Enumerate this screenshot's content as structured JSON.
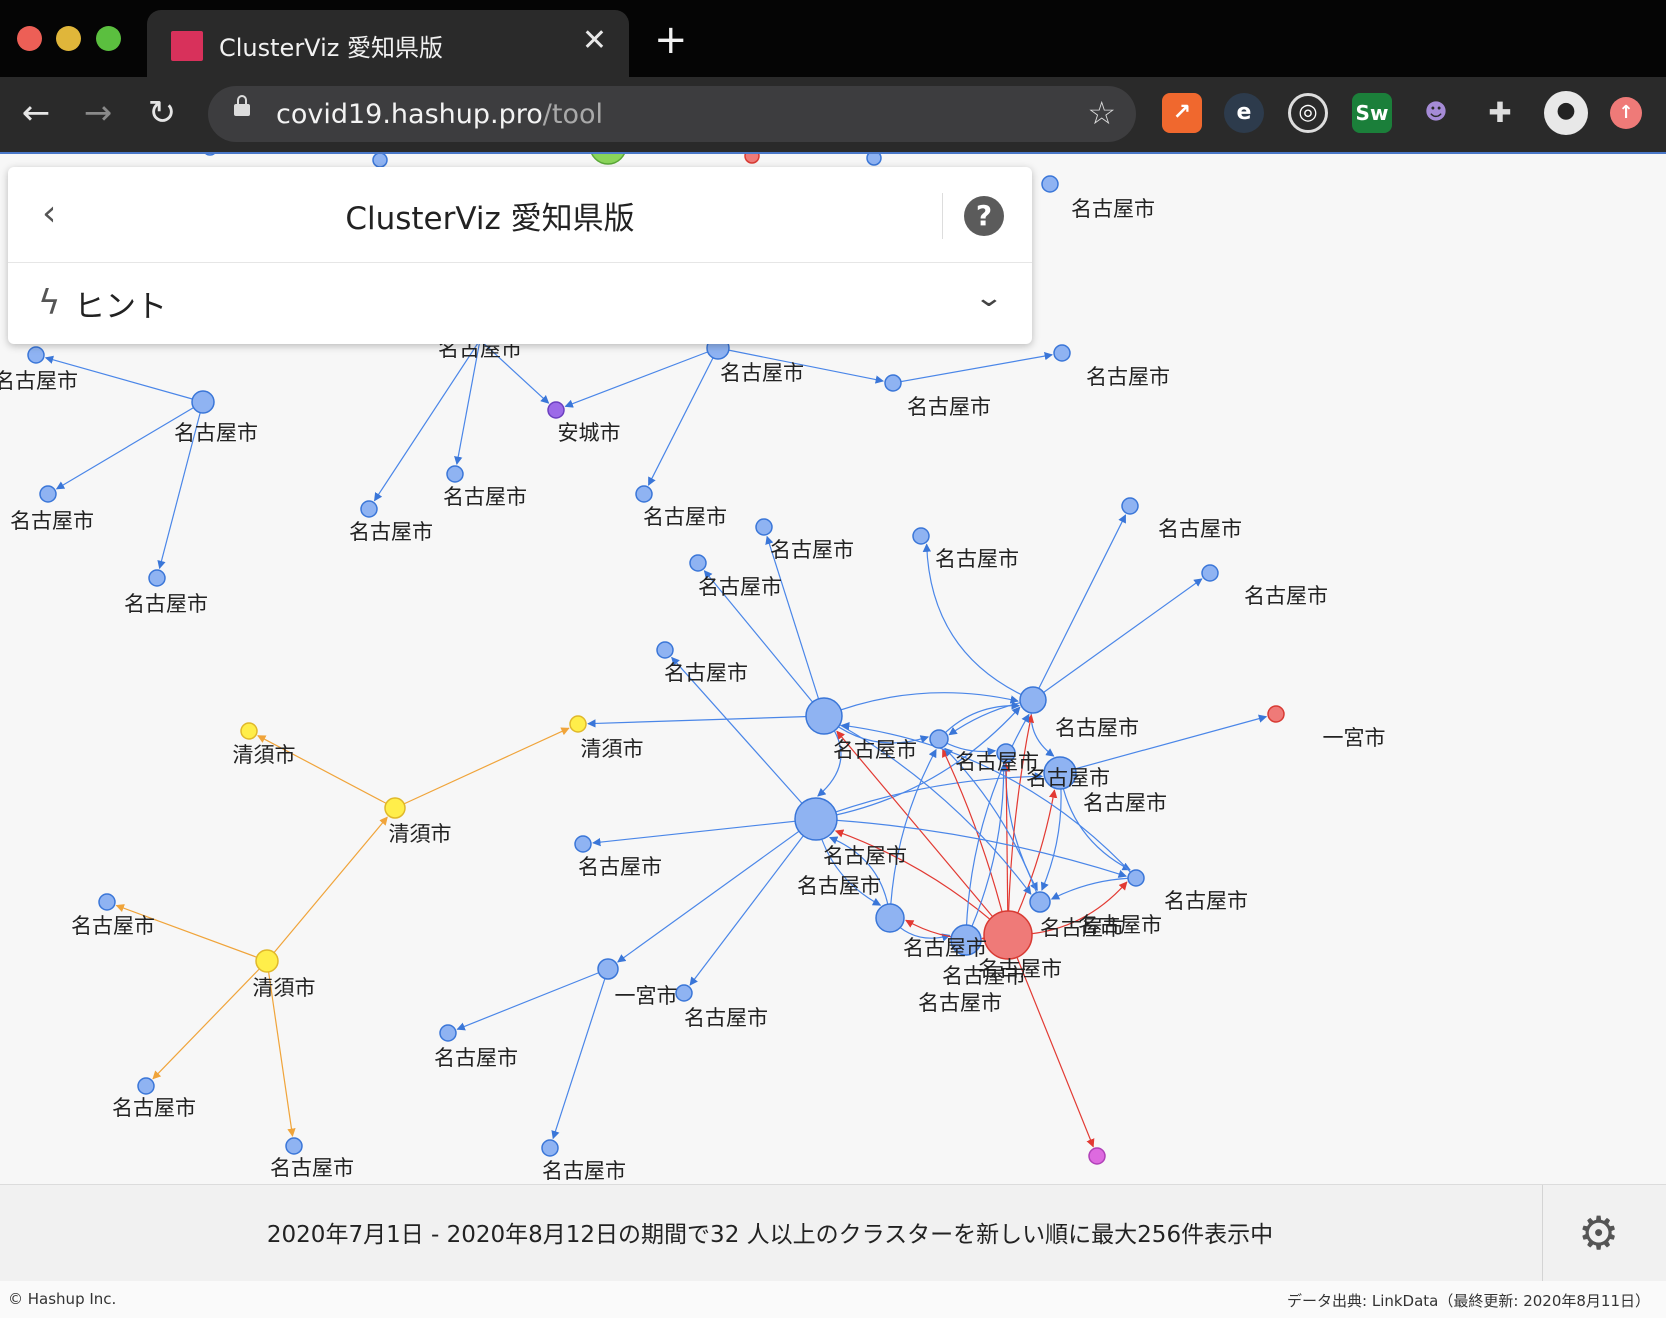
{
  "browser": {
    "tab_title": "ClusterViz 愛知県版",
    "url_host": "covid19.hashup.pro",
    "url_path": "/tool",
    "new_tab": "+",
    "close": "✕"
  },
  "colors": {
    "blue_node": "#8fb3f2",
    "blue_edge": "#4a86e8",
    "red_node": "#ef7a78",
    "red_edge": "#e23a33",
    "yellow_node": "#ffee4a",
    "orange_edge": "#f0a43a",
    "purple_node": "#9c6ae8",
    "green_node": "#8ad45a"
  },
  "header": {
    "title": "ClusterViz 愛知県版",
    "hint_label": "ヒント"
  },
  "graph": {
    "labels": [
      "名古屋市",
      "名古屋市",
      "名古屋市",
      "名古屋市",
      "名古屋市",
      "名古屋市",
      "名古屋市",
      "名古屋市",
      "安城市",
      "名古屋市",
      "名古屋市",
      "名古屋市",
      "名古屋市",
      "名古屋市",
      "名古屋市",
      "名古屋市",
      "名古屋市",
      "名古屋市",
      "名古屋市",
      "名古屋市",
      "名古屋市",
      "一宮市",
      "清須市",
      "清須市",
      "清須市",
      "清須市",
      "名古屋市",
      "名古屋市",
      "名古屋市",
      "名古屋市",
      "名古屋市",
      "名古屋市",
      "名古屋市",
      "名古屋市",
      "名古屋市",
      "名古屋市",
      "名古屋市",
      "名古屋市",
      "名古屋市",
      "名古屋市",
      "名古屋市",
      "名古屋市",
      "一宮市",
      "名古屋市",
      "名古屋市",
      "名古屋市",
      "名古屋市",
      "名古屋市"
    ]
  },
  "bottom": {
    "summary": "2020年7月1日 - 2020年8月12日の期間で32 人以上のクラスターを新しい順に最大256件表示中"
  },
  "footer": {
    "copyright": "© Hashup Inc.",
    "source": "データ出典: LinkData（最終更新: 2020年8月11日）"
  }
}
